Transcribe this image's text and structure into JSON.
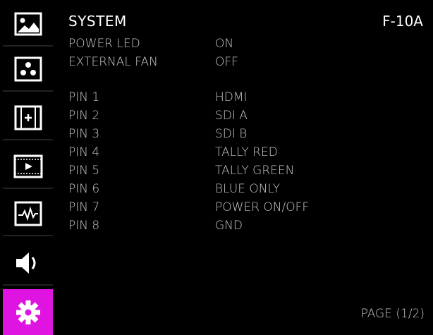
{
  "sidebar": {
    "tabs": [
      {
        "icon": "picture-icon"
      },
      {
        "icon": "color-dots-icon"
      },
      {
        "icon": "aspect-marker-icon"
      },
      {
        "icon": "film-play-icon"
      },
      {
        "icon": "waveform-icon"
      },
      {
        "icon": "speaker-icon"
      },
      {
        "icon": "gear-icon",
        "active": true
      }
    ],
    "active_color": "#e014e0"
  },
  "panel": {
    "title": "SYSTEM",
    "model": "F-10A",
    "rows": [
      {
        "key": "POWER LED",
        "value": "ON"
      },
      {
        "key": "EXTERNAL FAN",
        "value": "OFF"
      },
      {
        "key": "PIN 1",
        "value": "HDMI"
      },
      {
        "key": "PIN 2",
        "value": "SDI A"
      },
      {
        "key": "PIN 3",
        "value": "SDI B"
      },
      {
        "key": "PIN 4",
        "value": "TALLY RED"
      },
      {
        "key": "PIN 5",
        "value": "TALLY GREEN"
      },
      {
        "key": "PIN 6",
        "value": "BLUE ONLY"
      },
      {
        "key": "PIN 7",
        "value": "POWER ON/OFF"
      },
      {
        "key": "PIN 8",
        "value": "GND"
      }
    ],
    "page": "PAGE (1/2)"
  }
}
